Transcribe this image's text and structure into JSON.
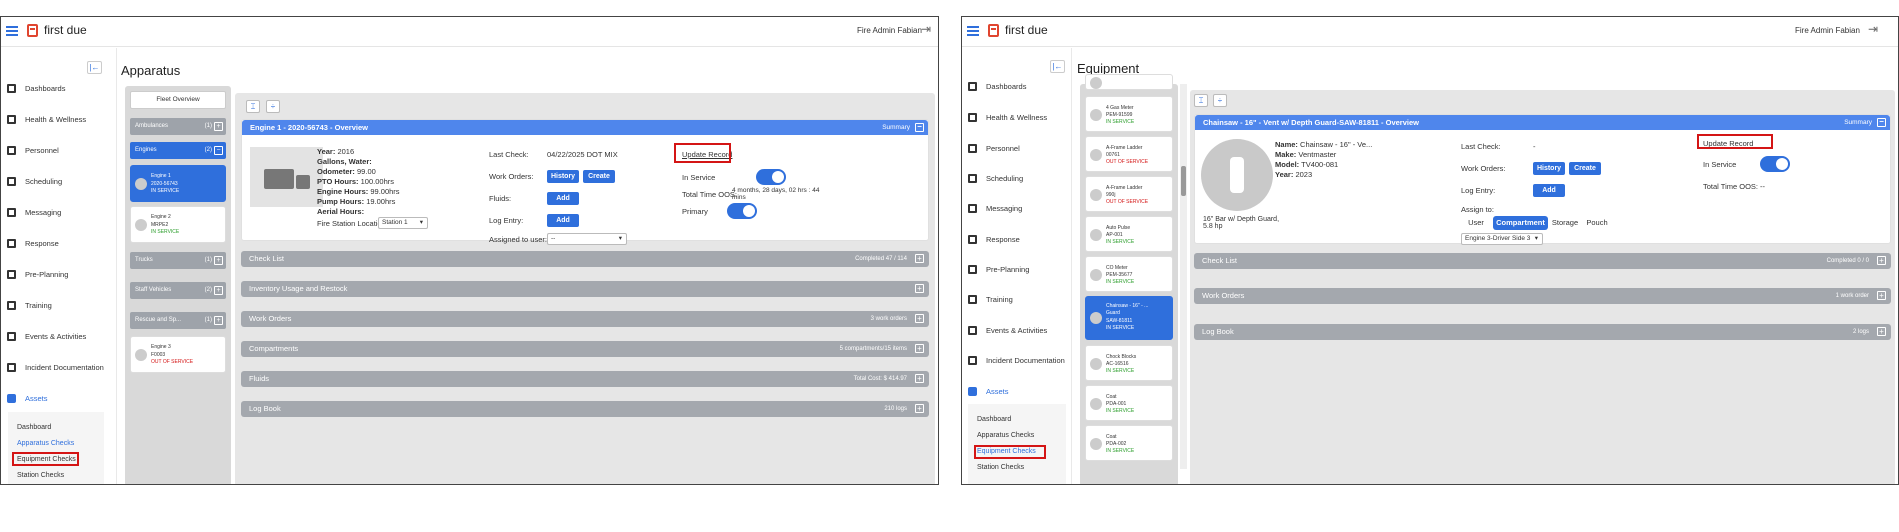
{
  "app": {
    "brand": "first due",
    "user": "Fire Admin Fabian"
  },
  "nav": {
    "items": [
      "Dashboards",
      "Health & Wellness",
      "Personnel",
      "Scheduling",
      "Messaging",
      "Response",
      "Pre-Planning",
      "Training",
      "Events & Activities",
      "Incident Documentation",
      "Assets"
    ]
  },
  "left": {
    "page_title": "Apparatus",
    "sub_nav": [
      "Dashboard",
      "Apparatus Checks",
      "Equipment Checks",
      "Station Checks"
    ],
    "fleet_header": "Fleet Overview",
    "groups": [
      {
        "name": "Ambulances",
        "count": "(1)",
        "pm": "+"
      },
      {
        "name": "Engines",
        "count": "(2)",
        "pm": "−"
      },
      {
        "name": "Trucks",
        "count": "(1)",
        "pm": "+"
      },
      {
        "name": "Staff Vehicles",
        "count": "(2)",
        "pm": "+"
      },
      {
        "name": "Rescue and Sp...",
        "count": "(1)",
        "pm": "+"
      }
    ],
    "units": [
      {
        "name": "Engine 1",
        "id": "2020-56743",
        "status": "IN SERVICE"
      },
      {
        "name": "Engine 2",
        "id": "MRPE2",
        "status": "IN SERVICE"
      },
      {
        "name": "Engine 3",
        "id": "F0003",
        "status": "OUT OF SERVICE"
      }
    ],
    "overview": {
      "title": "Engine 1 - 2020-56743 - Overview",
      "summary": "Summary",
      "year_l": "Year:",
      "year": "2016",
      "gallons_l": "Gallons, Water:",
      "odo_l": "Odometer:",
      "odo": "99.00",
      "pto_l": "PTO Hours:",
      "pto": "100.00hrs",
      "eng_l": "Engine Hours:",
      "eng": "99.00hrs",
      "pump_l": "Pump Hours:",
      "pump": "19.00hrs",
      "aerial_l": "Aerial Hours:",
      "station_l": "Fire Station Location:",
      "station": "Station 1",
      "lastcheck_l": "Last Check:",
      "lastcheck": "04/22/2025 DOT MIX",
      "wo_l": "Work Orders:",
      "history": "History",
      "create": "Create",
      "fluids_l": "Fluids:",
      "add": "Add",
      "log_l": "Log Entry:",
      "assigned_l": "Assigned to user:",
      "assigned": "--",
      "update": "Update Record",
      "inservice_l": "In Service",
      "oos_l": "Total Time OOS:",
      "oos": "4 months, 28 days, 02 hrs : 44 mins",
      "primary_l": "Primary"
    },
    "sections": [
      {
        "title": "Check List",
        "meta": "Completed 47 / 114"
      },
      {
        "title": "Inventory Usage and Restock",
        "meta": ""
      },
      {
        "title": "Work Orders",
        "meta": "3 work orders"
      },
      {
        "title": "Compartments",
        "meta": "5 compartments/15 items"
      },
      {
        "title": "Fluids",
        "meta": "Total Cost: $ 414.97"
      },
      {
        "title": "Log Book",
        "meta": "210 logs"
      }
    ]
  },
  "right": {
    "page_title": "Equipment",
    "sub_nav": [
      "Dashboard",
      "Apparatus Checks",
      "Equipment Checks",
      "Station Checks"
    ],
    "units": [
      {
        "name": "",
        "id": "",
        "status": ""
      },
      {
        "name": "4 Gas Meter",
        "id": "PEM-91599",
        "status": "IN SERVICE"
      },
      {
        "name": "A-Frame Ladder",
        "id": "00761",
        "status": "OUT OF SERVICE"
      },
      {
        "name": "A-Frame Ladder",
        "id": "990j",
        "status": "OUT OF SERVICE"
      },
      {
        "name": "Auto Pulse",
        "id": "AP-001",
        "status": "IN SERVICE"
      },
      {
        "name": "CO Meter",
        "id": "PEM-35677",
        "status": "IN SERVICE"
      },
      {
        "name": "Chainsaw - 16\" - ...",
        "name2": "Guard",
        "id": "SAW-81811",
        "status": "IN SERVICE"
      },
      {
        "name": "Chock Blocks",
        "id": "AC-16516",
        "status": "IN SERVICE"
      },
      {
        "name": "Coat",
        "id": "PDA-001",
        "status": "IN SERVICE"
      },
      {
        "name": "Coat",
        "id": "PDA-002",
        "status": "IN SERVICE"
      }
    ],
    "overview": {
      "title": "Chainsaw - 16\" - Vent w/ Depth Guard-SAW-81811 - Overview",
      "summary": "Summary",
      "name_l": "Name:",
      "name": "Chainsaw - 16\" - Ve...",
      "make_l": "Make:",
      "make": "Ventmaster",
      "model_l": "Model:",
      "model": "TV400-081",
      "year_l": "Year:",
      "year": "2023",
      "caption": "16\" Bar w/ Depth Guard, 5.8 hp",
      "lastcheck_l": "Last Check:",
      "lastcheck": "-",
      "wo_l": "Work Orders:",
      "history": "History",
      "create": "Create",
      "log_l": "Log Entry:",
      "add": "Add",
      "assign_l": "Assign to:",
      "assign_opts": [
        "User",
        "Compartment",
        "Storage",
        "Pouch"
      ],
      "assign_sel": "Engine 3-Driver Side 3",
      "update": "Update Record",
      "inservice_l": "In Service",
      "oos_l": "Total Time OOS:",
      "oos": "--"
    },
    "sections": [
      {
        "title": "Check List",
        "meta": "Completed 0 / 0"
      },
      {
        "title": "Work Orders",
        "meta": "1 work order"
      },
      {
        "title": "Log Book",
        "meta": "2 logs"
      }
    ]
  }
}
